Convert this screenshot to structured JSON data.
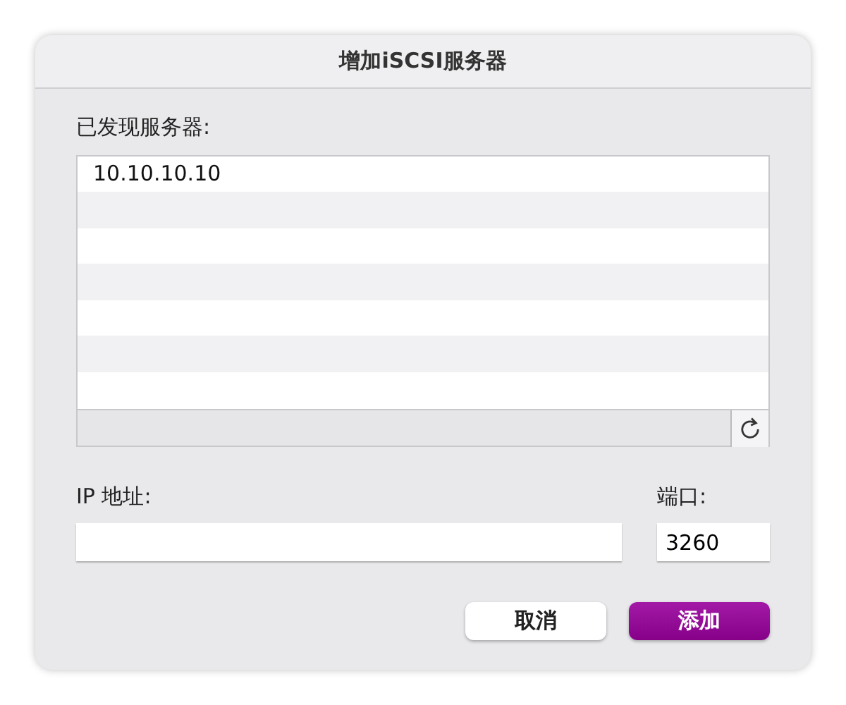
{
  "window": {
    "title": "增加iSCSI服务器"
  },
  "servers": {
    "label": "已发现服务器:",
    "items": [
      {
        "address": "10.10.10.10",
        "selected": false
      }
    ]
  },
  "ip_field": {
    "label": "IP 地址:"
  },
  "port_field": {
    "label": "端口:",
    "value": "3260"
  },
  "buttons": [
    {
      "label": "取消",
      "kind": "default"
    },
    {
      "label": "添加",
      "kind": "primary"
    }
  ]
}
